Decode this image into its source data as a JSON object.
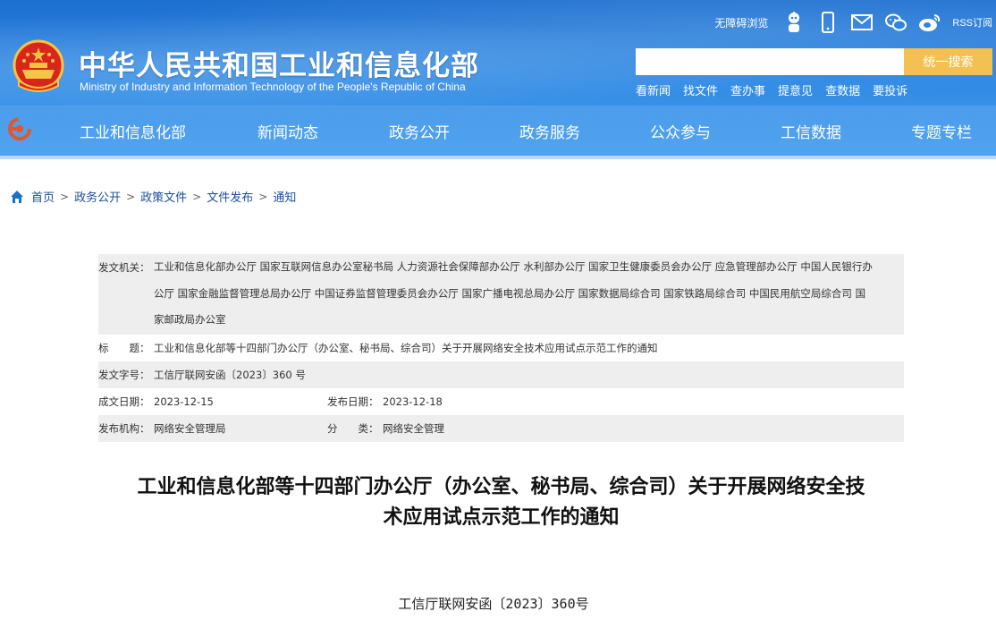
{
  "header": {
    "site_title": "中华人民共和国工业和信息化部",
    "site_subtitle": "Ministry of Industry and Information Technology of the People's Republic of China",
    "accessibility": "无障碍浏览",
    "rss": "RSS订阅",
    "search_placeholder": "",
    "search_button": "统一搜索",
    "quick_links": [
      "看新闻",
      "找文件",
      "查办事",
      "提意见",
      "查数据",
      "要投诉"
    ],
    "colors": {
      "primary": "#2a86e3",
      "accent": "#f3c052"
    }
  },
  "nav": {
    "items": [
      "工业和信息化部",
      "新闻动态",
      "政务公开",
      "政务服务",
      "公众参与",
      "工信数据",
      "专题专栏"
    ]
  },
  "breadcrumb": {
    "items": [
      "首页",
      "政务公开",
      "政策文件",
      "文件发布",
      "通知"
    ]
  },
  "info": {
    "issuer_label": "发文机关：",
    "issuer_lines": [
      "工业和信息化部办公厅 国家互联网信息办公室秘书局 人力资源社会保障部办公厅 水利部办公厅 国家卫生健康委员会办公厅 应急管理部办公厅 中国人民银行办",
      "公厅 国家金融监督管理总局办公厅 中国证券监督管理委员会办公厅 国家广播电视总局办公厅 国家数据局综合司 国家铁路局综合司 中国民用航空局综合司 国",
      "家邮政局办公室"
    ],
    "title_label": "标　　题：",
    "title_value": "工业和信息化部等十四部门办公厅（办公室、秘书局、综合司）关于开展网络安全技术应用试点示范工作的通知",
    "doc_no_label": "发文字号：",
    "doc_no_value": "工信厅联网安函〔2023〕360 号",
    "created_label": "成文日期：",
    "created_value": "2023-12-15",
    "published_label": "发布日期：",
    "published_value": "2023-12-18",
    "org_label": "发布机构：",
    "org_value": "网络安全管理局",
    "category_label": "分　　类：",
    "category_value": "网络安全管理"
  },
  "article": {
    "title_line1": "工业和信息化部等十四部门办公厅（办公室、秘书局、综合司）关于开展网络安全技",
    "title_line2": "术应用试点示范工作的通知",
    "doc_number": "工信厅联网安函〔2023〕360号"
  }
}
